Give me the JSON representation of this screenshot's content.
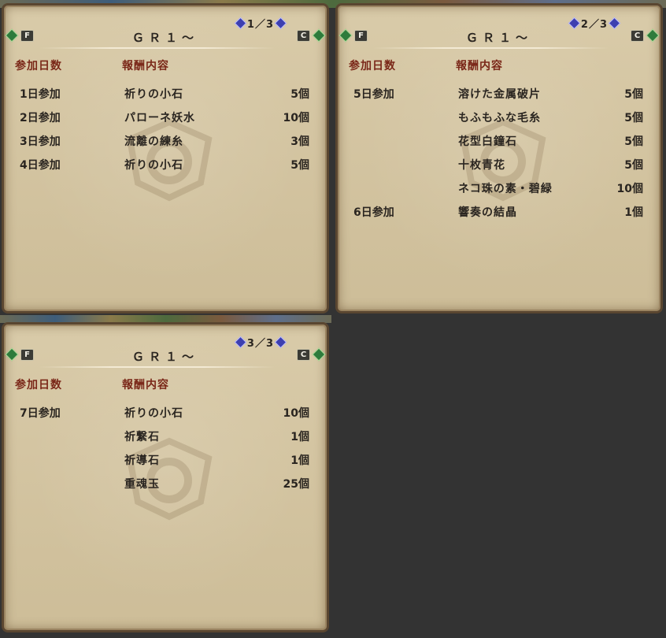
{
  "panels": [
    {
      "title": "ＧＲ１～",
      "page": "1／3",
      "f_label": "F",
      "c_label": "C",
      "headers": {
        "day": "参加日数",
        "reward": "報酬内容"
      },
      "rows": [
        {
          "day": "1日参加",
          "item": "祈りの小石",
          "qty": "5個"
        },
        {
          "day": "2日参加",
          "item": "パローネ妖水",
          "qty": "10個"
        },
        {
          "day": "3日参加",
          "item": "流離の練糸",
          "qty": "3個"
        },
        {
          "day": "4日参加",
          "item": "祈りの小石",
          "qty": "5個"
        }
      ]
    },
    {
      "title": "ＧＲ１～",
      "page": "2／3",
      "f_label": "F",
      "c_label": "C",
      "headers": {
        "day": "参加日数",
        "reward": "報酬内容"
      },
      "rows": [
        {
          "day": "5日参加",
          "item": "溶けた金属破片",
          "qty": "5個"
        },
        {
          "day": "",
          "item": "もふもふな毛糸",
          "qty": "5個"
        },
        {
          "day": "",
          "item": "花型白鐘石",
          "qty": "5個"
        },
        {
          "day": "",
          "item": "十枚青花",
          "qty": "5個"
        },
        {
          "day": "",
          "item": "ネコ珠の素・碧緑",
          "qty": "10個"
        },
        {
          "day": "6日参加",
          "item": "響奏の結晶",
          "qty": "1個"
        }
      ]
    },
    {
      "title": "ＧＲ１～",
      "page": "3／3",
      "f_label": "F",
      "c_label": "C",
      "headers": {
        "day": "参加日数",
        "reward": "報酬内容"
      },
      "rows": [
        {
          "day": "7日参加",
          "item": "祈りの小石",
          "qty": "10個"
        },
        {
          "day": "",
          "item": "祈繋石",
          "qty": "1個"
        },
        {
          "day": "",
          "item": "祈導石",
          "qty": "1個"
        },
        {
          "day": "",
          "item": "重魂玉",
          "qty": "25個"
        }
      ]
    }
  ],
  "colors": {
    "parchment": "#d4c5a2",
    "header_text": "#7a2718",
    "body_text": "#2a2520",
    "background": "#333333"
  }
}
